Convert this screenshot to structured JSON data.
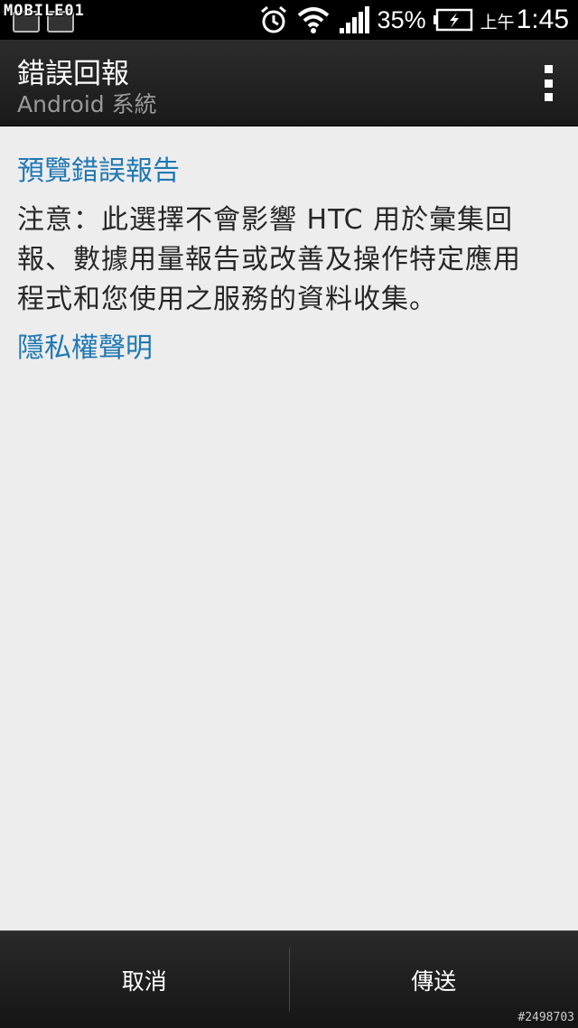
{
  "status_bar": {
    "watermark": "MOBILE01",
    "battery_percent": "35%",
    "clock_ampm": "上午",
    "clock_time": "1:45",
    "icons": [
      "notification-icon",
      "notification-icon",
      "alarm-icon",
      "wifi-icon",
      "signal-icon",
      "battery-charging-icon"
    ]
  },
  "action_bar": {
    "title": "錯誤回報",
    "subtitle": "Android 系統",
    "overflow_icon": "overflow-menu-icon"
  },
  "content": {
    "preview_link": "預覽錯誤報告",
    "notice_lines": [
      "注意：此選擇不會影響 HTC 用於彙集回",
      "報、數據用量報告或改善及操作特定應用",
      "程式和您使用之服務的資料收集。"
    ],
    "privacy_link": "隱私權聲明"
  },
  "bottom_bar": {
    "cancel_label": "取消",
    "send_label": "傳送"
  },
  "image_id": "#2498703",
  "colors": {
    "link": "#1f78b4",
    "background": "#ededed",
    "bar": "#1a1a1a"
  }
}
